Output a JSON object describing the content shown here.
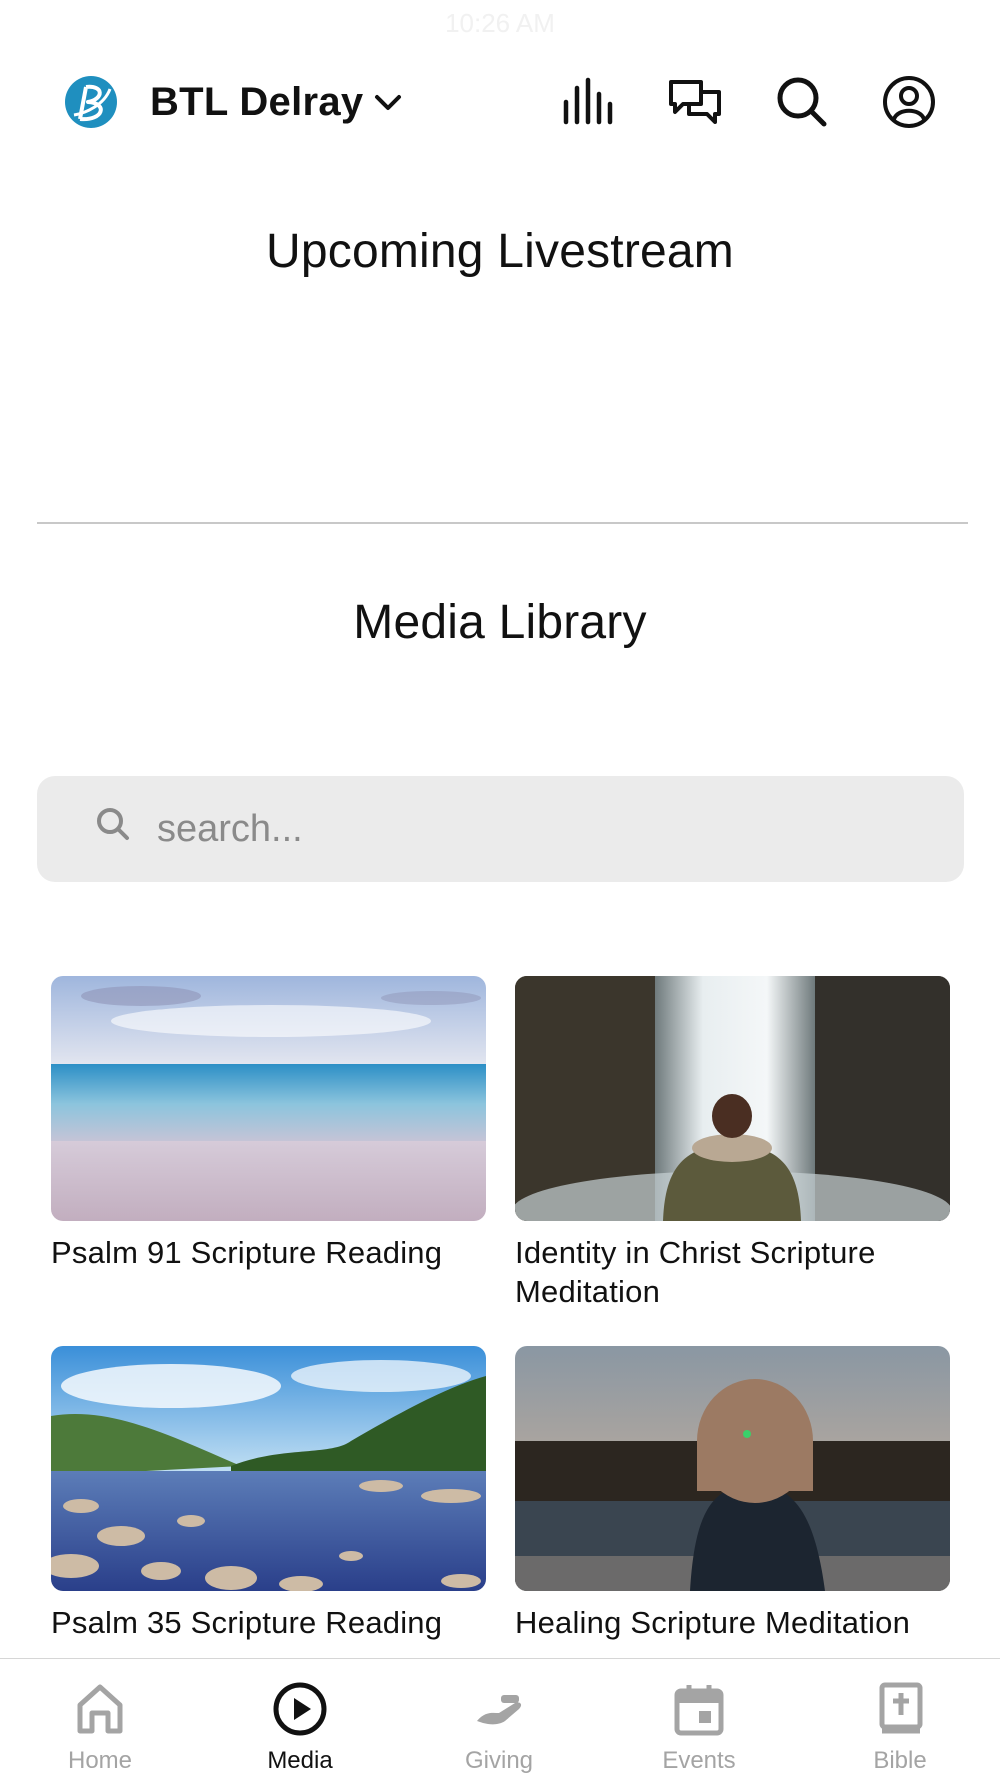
{
  "status_bar": {
    "time": "10:26 AM"
  },
  "header": {
    "org_name": "BTL Delray",
    "icons": [
      "audio-icon",
      "chat-icon",
      "search-icon",
      "profile-icon"
    ]
  },
  "livestream": {
    "title": "Upcoming Livestream"
  },
  "library": {
    "title": "Media Library",
    "search_placeholder": "search...",
    "items": [
      {
        "title": "Psalm 91 Scripture Reading"
      },
      {
        "title": "Identity in Christ Scripture Meditation"
      },
      {
        "title": "Psalm 35 Scripture Reading"
      },
      {
        "title": "Healing Scripture Meditation"
      }
    ]
  },
  "tabs": [
    {
      "label": "Home",
      "icon": "home-icon",
      "active": false
    },
    {
      "label": "Media",
      "icon": "play-circle-icon",
      "active": true
    },
    {
      "label": "Giving",
      "icon": "giving-hand-icon",
      "active": false
    },
    {
      "label": "Events",
      "icon": "calendar-icon",
      "active": false
    },
    {
      "label": "Bible",
      "icon": "bible-icon",
      "active": false
    }
  ],
  "colors": {
    "brand": "#1f8fbf",
    "tab_active": "#111111",
    "tab_inactive": "#a4a4a4",
    "search_bg": "#ebebeb"
  }
}
